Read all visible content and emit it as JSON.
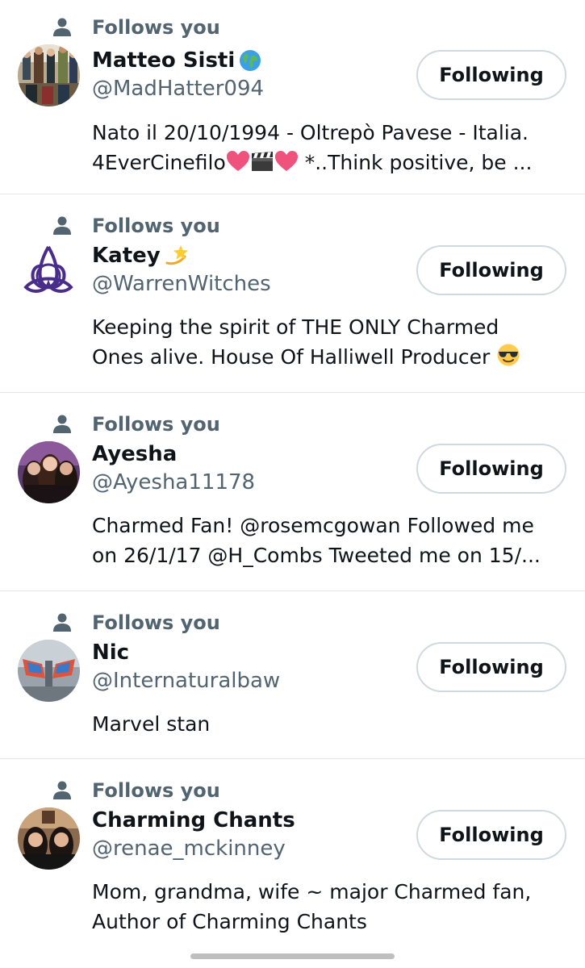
{
  "social_context_label": "Follows you",
  "button_label": "Following",
  "users": [
    {
      "name": "Matteo Sisti",
      "name_emoji": "globe-emoji",
      "handle": "@MadHatter094",
      "bio_lines": [
        "Nato il 20/10/1994 - Oltrepò Pavese - Italia.",
        "4EverCinefilo",
        "*..Think positive, be ..."
      ]
    },
    {
      "name": "Katey",
      "name_emoji": "dizzy-star-emoji",
      "handle": "@WarrenWitches",
      "bio_lines": [
        "Keeping the spirit of THE ONLY Charmed",
        "Ones alive. House Of Halliwell Producer"
      ]
    },
    {
      "name": "Ayesha",
      "handle": "@Ayesha11178",
      "bio_lines": [
        "Charmed Fan! @rosemcgowan Followed me",
        "on 26/1/17 @H_Combs Tweeted me on 15/..."
      ]
    },
    {
      "name": "Nic",
      "handle": "@Internaturalbaw",
      "bio_lines": [
        "Marvel stan"
      ]
    },
    {
      "name": "Charming Chants",
      "handle": "@renae_mckinney",
      "bio_lines": [
        "Mom, grandma, wife ~ major Charmed fan,",
        "Author of Charming Chants"
      ]
    }
  ],
  "colors": {
    "text_primary": "#0f1419",
    "text_secondary": "#536471",
    "divider": "#e3e7ea",
    "button_border": "#cfd9de"
  }
}
